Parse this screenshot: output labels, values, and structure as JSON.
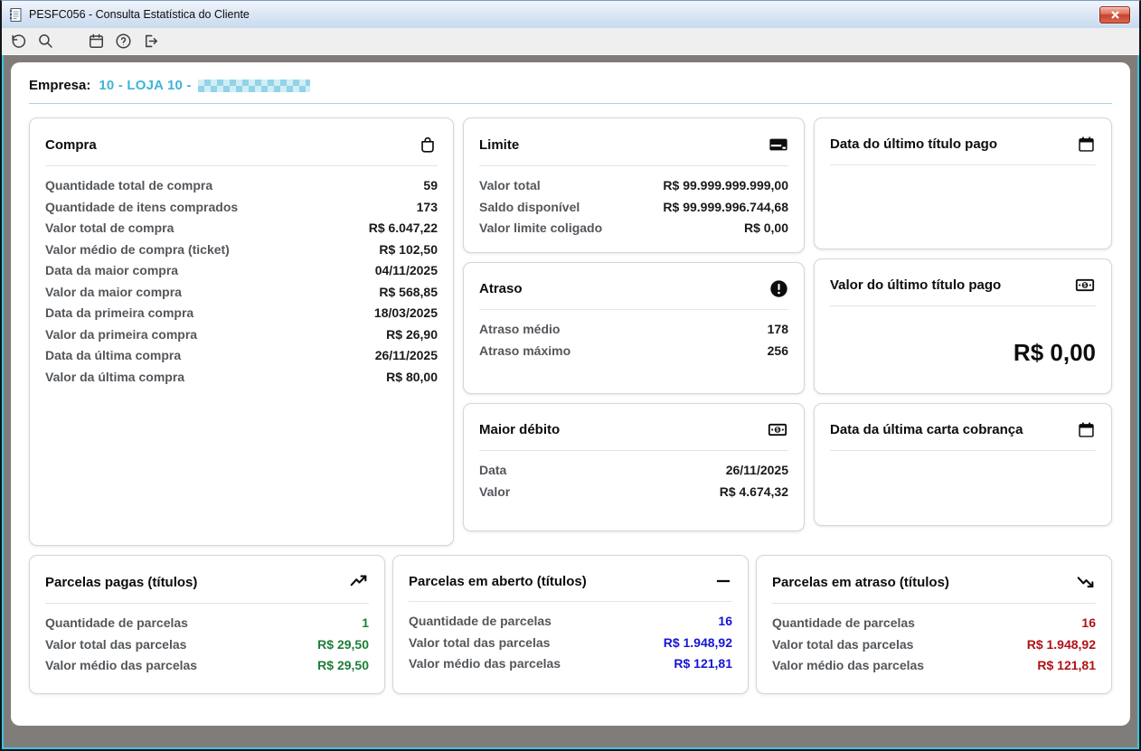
{
  "window": {
    "title": "PESFC056 - Consulta Estatística do Cliente",
    "app_icon": "document-icon",
    "close_icon": "close-icon"
  },
  "toolbar": {
    "icons": [
      "undo-icon",
      "search-icon",
      "calendar-icon",
      "help-icon",
      "exit-icon"
    ]
  },
  "header": {
    "label": "Empresa:",
    "company": "10 - LOJA 10 -",
    "company_redacted": true
  },
  "cards": {
    "compra": {
      "title": "Compra",
      "icon": "shopping-bag-icon",
      "rows": [
        {
          "label": "Quantidade total de compra",
          "value": "59"
        },
        {
          "label": "Quantidade de itens comprados",
          "value": "173"
        },
        {
          "label": "Valor total de compra",
          "value": "R$ 6.047,22"
        },
        {
          "label": "Valor médio de compra (ticket)",
          "value": "R$ 102,50"
        },
        {
          "label": "Data da maior compra",
          "value": "04/11/2025"
        },
        {
          "label": "Valor da maior compra",
          "value": "R$ 568,85"
        },
        {
          "label": "Data da primeira compra",
          "value": "18/03/2025"
        },
        {
          "label": "Valor da primeira compra",
          "value": "R$ 26,90"
        },
        {
          "label": "Data da última compra",
          "value": "26/11/2025"
        },
        {
          "label": "Valor da última compra",
          "value": "R$ 80,00"
        }
      ]
    },
    "limite": {
      "title": "Limite",
      "icon": "credit-card-icon",
      "rows": [
        {
          "label": "Valor total",
          "value": "R$ 99.999.999.999,00"
        },
        {
          "label": "Saldo disponível",
          "value": "R$ 99.999.996.744,68"
        },
        {
          "label": "Valor limite coligado",
          "value": "R$ 0,00"
        }
      ]
    },
    "atraso": {
      "title": "Atraso",
      "icon": "exclamation-circle-icon",
      "rows": [
        {
          "label": "Atraso médio",
          "value": "178"
        },
        {
          "label": "Atraso máximo",
          "value": "256"
        }
      ]
    },
    "maior_debito": {
      "title": "Maior débito",
      "icon": "cash-icon",
      "rows": [
        {
          "label": "Data",
          "value": "26/11/2025"
        },
        {
          "label": "Valor",
          "value": "R$ 4.674,32"
        }
      ]
    },
    "data_ultimo_titulo_pago": {
      "title": "Data do último título pago",
      "icon": "calendar-icon",
      "value": ""
    },
    "valor_ultimo_titulo_pago": {
      "title": "Valor do último título pago",
      "icon": "cash-icon",
      "value": "R$ 0,00"
    },
    "data_ultima_carta_cobranca": {
      "title": "Data da última carta cobrança",
      "icon": "calendar-icon",
      "value": ""
    },
    "parcelas_pagas": {
      "title": "Parcelas pagas (títulos)",
      "icon": "trend-up-icon",
      "accent": "#1e7e3a",
      "rows": [
        {
          "label": "Quantidade de parcelas",
          "value": "1"
        },
        {
          "label": "Valor total das parcelas",
          "value": "R$ 29,50"
        },
        {
          "label": "Valor médio das parcelas",
          "value": "R$ 29,50"
        }
      ]
    },
    "parcelas_em_aberto": {
      "title": "Parcelas em aberto (títulos)",
      "icon": "dash-icon",
      "accent": "#1515d6",
      "rows": [
        {
          "label": "Quantidade de parcelas",
          "value": "16"
        },
        {
          "label": "Valor total das parcelas",
          "value": "R$ 1.948,92"
        },
        {
          "label": "Valor médio das parcelas",
          "value": "R$ 121,81"
        }
      ]
    },
    "parcelas_em_atraso": {
      "title": "Parcelas em atraso (títulos)",
      "icon": "trend-down-icon",
      "accent": "#b01218",
      "rows": [
        {
          "label": "Quantidade de parcelas",
          "value": "16"
        },
        {
          "label": "Valor total das parcelas",
          "value": "R$ 1.948,92"
        },
        {
          "label": "Valor médio das parcelas",
          "value": "R$ 121,81"
        }
      ]
    }
  },
  "colors": {
    "company_accent": "#3fb4d8",
    "paid_value_green": "#1e7e3a",
    "open_value_blue": "#1515d6",
    "overdue_value_red": "#b01218",
    "label_gray": "#53575b",
    "value_black": "#1a1a1a",
    "window_border_accent": "#3cc6e0",
    "titlebar_gradient_top": "#f1f6fc",
    "titlebar_gradient_bottom": "#c7daee",
    "main_background": "#807c7a"
  }
}
